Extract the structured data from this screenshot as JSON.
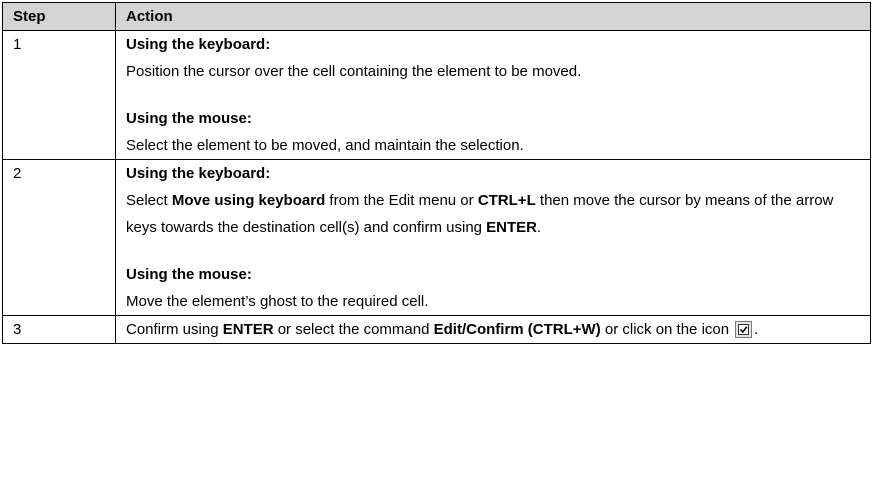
{
  "table": {
    "header": {
      "step": "Step",
      "action": "Action"
    },
    "row1": {
      "step": "1",
      "kb_heading": "Using the keyboard:",
      "kb_text": "Position the cursor over the cell containing the element to be moved.",
      "mouse_heading": "Using the mouse:",
      "mouse_text": "Select the element to be moved, and maintain the selection."
    },
    "row2": {
      "step": "2",
      "kb_heading": "Using the keyboard:",
      "kb_t1": "Select ",
      "kb_b1": "Move using keyboard",
      "kb_t2": " from the Edit menu or ",
      "kb_b2": "CTRL+L",
      "kb_t3": " then move the cursor by means of the arrow keys towards the destination cell(s) and confirm using ",
      "kb_b3": "ENTER",
      "kb_t4": ".",
      "mouse_heading": "Using the mouse:",
      "mouse_text": "Move the element’s ghost to the required cell."
    },
    "row3": {
      "step": "3",
      "t1": "Confirm using ",
      "b1": "ENTER",
      "t2": " or select the command ",
      "b2": "Edit/Confirm (CTRL+W)",
      "t3": " or click on the icon",
      "t4": ".",
      "icon": "confirm-checkbox-icon"
    }
  }
}
